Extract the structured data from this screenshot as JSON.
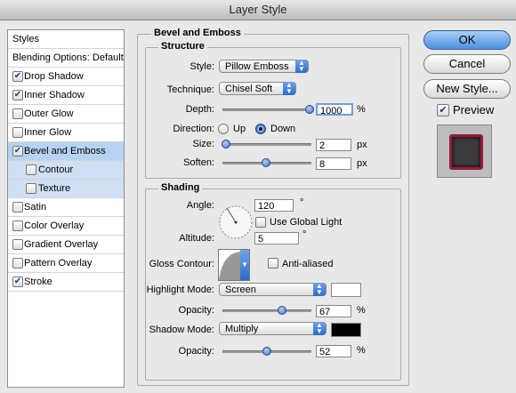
{
  "window": {
    "title": "Layer Style"
  },
  "sidebar": {
    "header": "Styles",
    "blending": "Blending Options: Default",
    "items": [
      {
        "label": "Drop Shadow",
        "checked": true
      },
      {
        "label": "Inner Shadow",
        "checked": true
      },
      {
        "label": "Outer Glow",
        "checked": false
      },
      {
        "label": "Inner Glow",
        "checked": false
      },
      {
        "label": "Bevel and Emboss",
        "checked": true
      },
      {
        "label": "Contour",
        "checked": false
      },
      {
        "label": "Texture",
        "checked": false
      },
      {
        "label": "Satin",
        "checked": false
      },
      {
        "label": "Color Overlay",
        "checked": false
      },
      {
        "label": "Gradient Overlay",
        "checked": false
      },
      {
        "label": "Pattern Overlay",
        "checked": false
      },
      {
        "label": "Stroke",
        "checked": true
      }
    ],
    "checkmark": "✔"
  },
  "bevel": {
    "section_title": "Bevel and Emboss",
    "structure": {
      "title": "Structure",
      "style_label": "Style:",
      "style_value": "Pillow Emboss",
      "technique_label": "Technique:",
      "technique_value": "Chisel Soft",
      "depth_label": "Depth:",
      "depth_value": "1000",
      "depth_unit": "%",
      "direction_label": "Direction:",
      "direction_up": "Up",
      "direction_down": "Down",
      "direction_selected": "Down",
      "size_label": "Size:",
      "size_value": "2",
      "size_unit": "px",
      "soften_label": "Soften:",
      "soften_value": "8",
      "soften_unit": "px"
    },
    "shading": {
      "title": "Shading",
      "angle_label": "Angle:",
      "angle_value": "120",
      "angle_unit": "°",
      "use_global_light": "Use Global Light",
      "altitude_label": "Altitude:",
      "altitude_value": "5",
      "altitude_unit": "°",
      "gloss_contour_label": "Gloss Contour:",
      "anti_aliased": "Anti-aliased",
      "highlight_mode_label": "Highlight Mode:",
      "highlight_mode_value": "Screen",
      "highlight_color": "#ffffff",
      "opacity_label": "Opacity:",
      "highlight_opacity": "67",
      "opacity_unit": "%",
      "shadow_mode_label": "Shadow Mode:",
      "shadow_mode_value": "Multiply",
      "shadow_color": "#000000",
      "shadow_opacity": "52"
    }
  },
  "buttons": {
    "ok": "OK",
    "cancel": "Cancel",
    "new_style": "New Style...",
    "preview": "Preview"
  },
  "colors": {
    "accent": "#4d8fe0",
    "preview_red": "#9b1a3a"
  }
}
